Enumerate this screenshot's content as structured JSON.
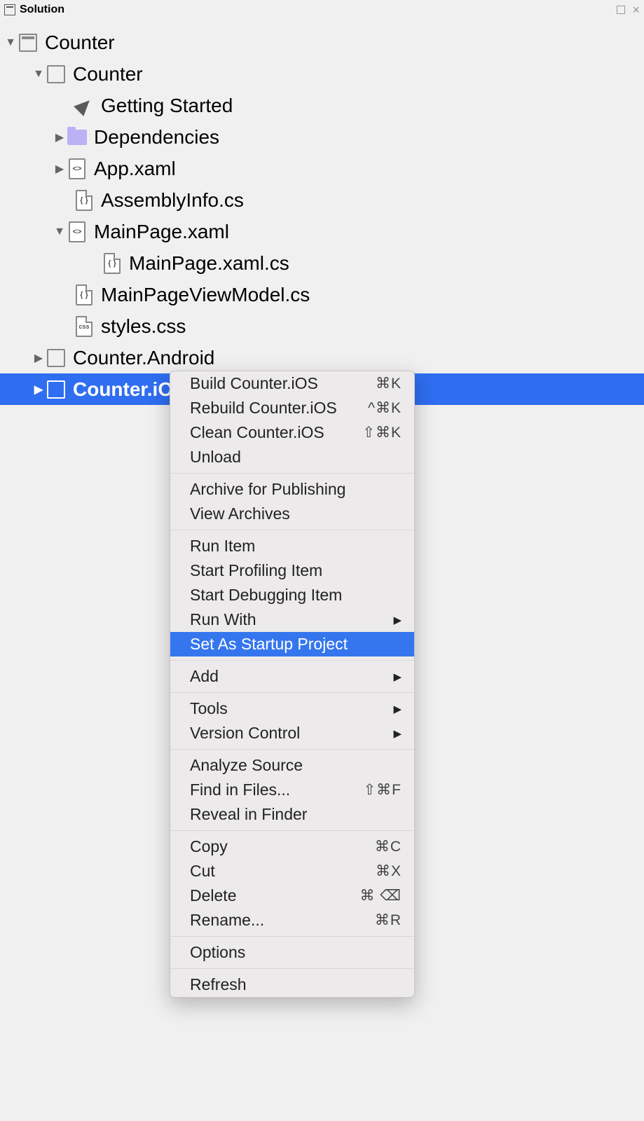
{
  "header": {
    "title": "Solution"
  },
  "tree": {
    "sln": "Counter",
    "proj": "Counter",
    "getting_started": "Getting Started",
    "deps": "Dependencies",
    "appxaml": "App.xaml",
    "asm": "AssemblyInfo.cs",
    "mainpage": "MainPage.xaml",
    "mainpage_cs": "MainPage.xaml.cs",
    "vm": "MainPageViewModel.cs",
    "styles": "styles.css",
    "android": "Counter.Android",
    "ios": "Counter.iOS"
  },
  "icons": {
    "xaml": "<>",
    "cs": "{ }",
    "css": "css"
  },
  "menu": {
    "build": "Build Counter.iOS",
    "rebuild": "Rebuild Counter.iOS",
    "clean": "Clean Counter.iOS",
    "unload": "Unload",
    "archive": "Archive for Publishing",
    "view_archives": "View Archives",
    "run_item": "Run Item",
    "start_profiling": "Start Profiling Item",
    "start_debugging": "Start Debugging Item",
    "run_with": "Run With",
    "startup": "Set As Startup Project",
    "add": "Add",
    "tools": "Tools",
    "vc": "Version Control",
    "analyze": "Analyze Source",
    "find": "Find in Files...",
    "reveal": "Reveal in Finder",
    "copy": "Copy",
    "cut": "Cut",
    "delete": "Delete",
    "rename": "Rename...",
    "options": "Options",
    "refresh": "Refresh"
  },
  "shortcuts": {
    "build": "⌘K",
    "rebuild": "^⌘K",
    "clean": "⇧⌘K",
    "find": "⇧⌘F",
    "copy": "⌘C",
    "cut": "⌘X",
    "delete": "⌘ ⌫",
    "rename": "⌘R"
  }
}
